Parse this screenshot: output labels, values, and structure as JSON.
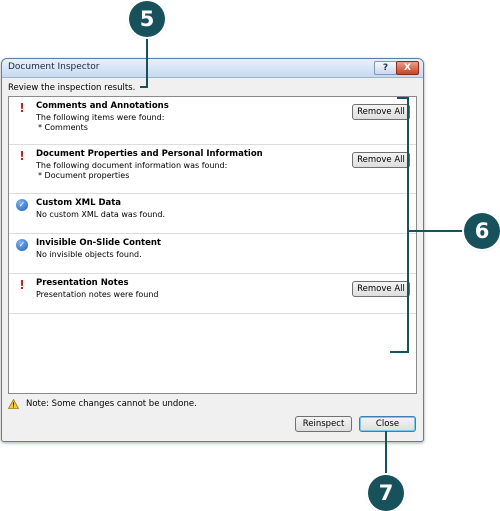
{
  "dialog": {
    "title": "Document Inspector",
    "help_label": "?",
    "close_label": "X",
    "review_text": "Review the inspection results.",
    "items": [
      {
        "status": "warning",
        "title": "Comments and Annotations",
        "description": "The following items were found:",
        "detail": "* Comments",
        "button": "Remove All"
      },
      {
        "status": "warning",
        "title": "Document Properties and Personal Information",
        "description": "The following document information was found:",
        "detail": "* Document properties",
        "button": "Remove All"
      },
      {
        "status": "ok",
        "title": "Custom XML Data",
        "description": "No custom XML data was found."
      },
      {
        "status": "ok",
        "title": "Invisible On-Slide Content",
        "description": "No invisible objects found."
      },
      {
        "status": "warning",
        "title": "Presentation Notes",
        "description": "Presentation notes were found",
        "button": "Remove All"
      }
    ],
    "note": "Note: Some changes cannot be undone.",
    "reinspect_label": "Reinspect",
    "close_button_label": "Close"
  },
  "callouts": {
    "c5": "5",
    "c6": "6",
    "c7": "7"
  },
  "icons": {
    "warning": "exclamation-icon",
    "ok": "check-circle-icon",
    "note": "warning-triangle-icon"
  },
  "colors": {
    "callout": "#16515c",
    "warning": "#c0242a",
    "ok": "#1c5fbf"
  }
}
